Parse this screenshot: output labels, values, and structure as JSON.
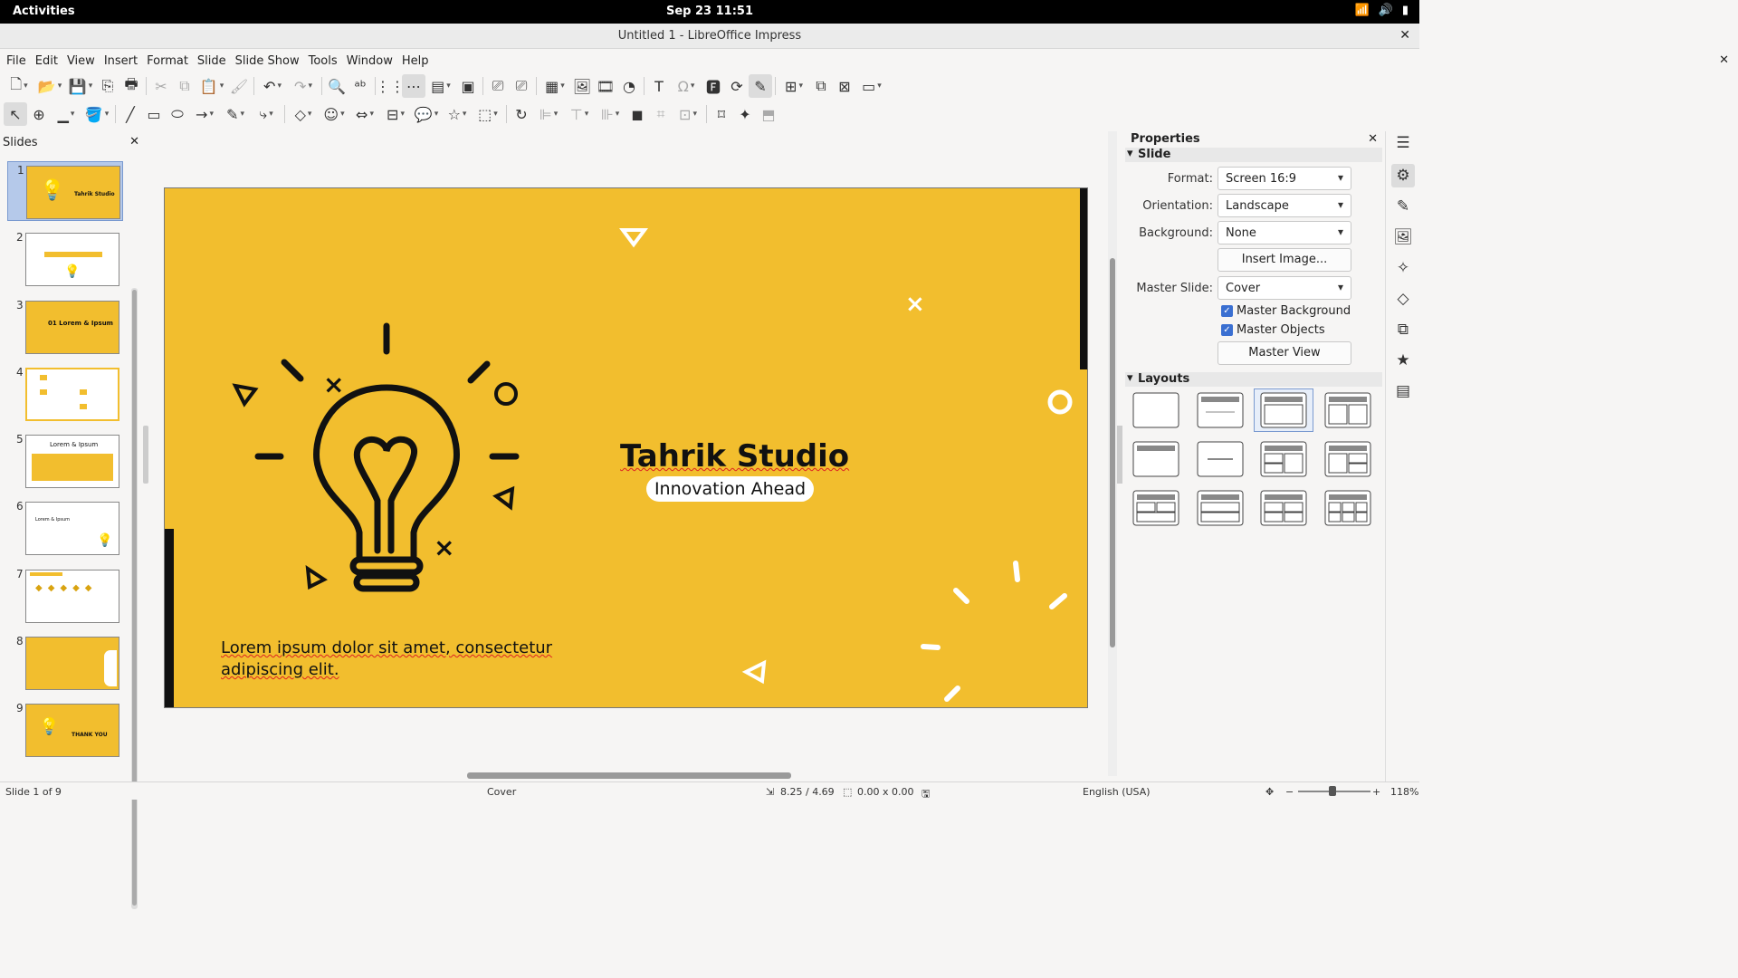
{
  "topbar": {
    "activities": "Activities",
    "clock": "Sep 23  11:51",
    "wifi_icon": "wifi-icon",
    "volume_icon": "volume-icon",
    "battery_icon": "battery-icon"
  },
  "window": {
    "title": "Untitled 1 - LibreOffice Impress",
    "close": "✕"
  },
  "menu": [
    "File",
    "Edit",
    "View",
    "Insert",
    "Format",
    "Slide",
    "Slide Show",
    "Tools",
    "Window",
    "Help"
  ],
  "slides_pane": {
    "title": "Slides",
    "close": "✕",
    "thumbs": [
      {
        "num": "1",
        "text": "Tahrik Studio"
      },
      {
        "num": "2",
        "text": ""
      },
      {
        "num": "3",
        "text": "01 Lorem & Ipsum"
      },
      {
        "num": "4",
        "text": ""
      },
      {
        "num": "5",
        "text": "Lorem & Ipsum"
      },
      {
        "num": "6",
        "text": "Lorem & Ipsum"
      },
      {
        "num": "7",
        "text": ""
      },
      {
        "num": "8",
        "text": ""
      },
      {
        "num": "9",
        "text": "THANK YOU"
      }
    ]
  },
  "slide": {
    "title": "Tahrik Studio",
    "subtitle": "Innovation Ahead",
    "body_line1": "Lorem ipsum dolor sit amet, consectetur",
    "body_line2": "adipiscing elit.",
    "background": "#f2be2e"
  },
  "properties": {
    "title": "Properties",
    "close": "✕",
    "slide_section": "Slide",
    "format_label": "Format:",
    "format_value": "Screen 16:9",
    "orientation_label": "Orientation:",
    "orientation_value": "Landscape",
    "background_label": "Background:",
    "background_value": "None",
    "insert_image": "Insert Image...",
    "master_slide_label": "Master Slide:",
    "master_slide_value": "Cover",
    "master_background": "Master Background",
    "master_objects": "Master Objects",
    "master_view": "Master View",
    "layouts_section": "Layouts"
  },
  "status": {
    "slide": "Slide 1 of 9",
    "master": "Cover",
    "position": "8.25 / 4.69",
    "size": "0.00 x 0.00",
    "language": "English (USA)",
    "zoom": "118%"
  }
}
